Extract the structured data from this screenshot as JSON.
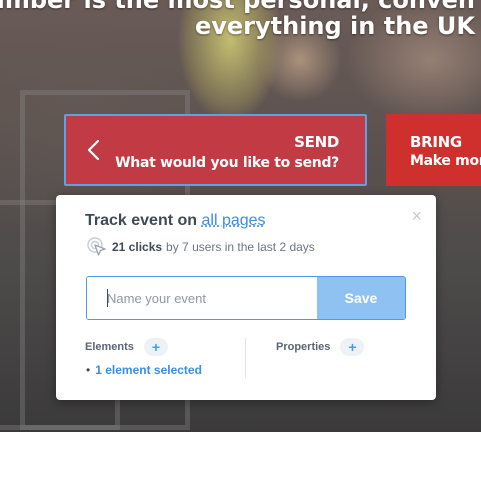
{
  "hero": {
    "line1": "Nimber is the most personal, conven",
    "line2": "everything in the UK"
  },
  "cards": {
    "send": {
      "title": "SEND",
      "subtitle": "What would you like to send?"
    },
    "bring": {
      "title": "BRING",
      "subtitle": "Make mon"
    }
  },
  "popup": {
    "title_prefix": "Track event on",
    "title_link": "all pages",
    "close_label": "×",
    "stats": {
      "clicks": "21 clicks",
      "detail": "by 7 users in the last 2 days"
    },
    "input": {
      "placeholder": "Name your event",
      "value": ""
    },
    "save_label": "Save",
    "elements": {
      "label": "Elements",
      "add": "+",
      "selected": "1 element selected",
      "bullet": "•"
    },
    "properties": {
      "label": "Properties",
      "add": "+"
    }
  },
  "colors": {
    "send_card": "#c23b44",
    "bring_card": "#d0302d",
    "accent": "#3a8ee8",
    "save_button": "#8fc1f2"
  },
  "icons": {
    "back": "chevron-left-icon",
    "close": "close-icon",
    "clicks": "cursor-click-icon"
  }
}
